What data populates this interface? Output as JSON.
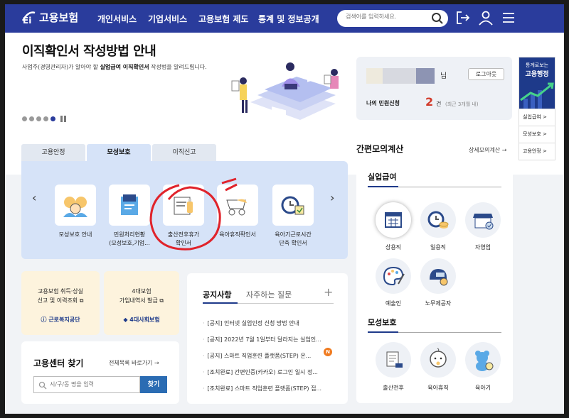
{
  "header": {
    "brand": "고용보험",
    "nav": [
      "개인서비스",
      "기업서비스",
      "고용보험 제도",
      "통계 및 정보공개"
    ],
    "search_placeholder": "검색어를 입력하세요."
  },
  "hero": {
    "title": "이직확인서 작성방법 안내",
    "subtitle_pre": "사업주(경영관리자)가 알아야 할 ",
    "subtitle_bold": "실업급여 이직확인서",
    "subtitle_post": " 작성법을 알려드립니다."
  },
  "user_card": {
    "name_suffix": "님",
    "logout": "로그아웃",
    "my_label": "나의 민원신청",
    "count": "2",
    "unit": "건",
    "period": "(최근 3개월 내)"
  },
  "side_panel": {
    "top_line1": "통계로보는",
    "top_line2": "고용행정",
    "items": [
      "실업급여 >",
      "모성보호 >",
      "고용안정 >"
    ]
  },
  "tabs": [
    "고용안정",
    "모성보호",
    "이직신고"
  ],
  "services": [
    {
      "label": "모성보호 안내",
      "icon": "family-icon"
    },
    {
      "label": "민원처리현황",
      "label2": "(모성보호,기업...",
      "icon": "folder-icon"
    },
    {
      "label": "출산전후휴가",
      "label2": "확인서",
      "icon": "document-bottle-icon"
    },
    {
      "label": "육아휴직확인서",
      "icon": "stroller-icon"
    },
    {
      "label": "육아기근로시간",
      "label2": "단축 확인서",
      "icon": "clock-calendar-icon"
    }
  ],
  "quick": [
    {
      "line1": "고용보험 취득·상실",
      "line2": "신고 및 이력조회",
      "org": "근로복지공단"
    },
    {
      "line1": "4대보험",
      "line2": "가입내역서 발급",
      "org": "4대사회보험"
    }
  ],
  "center": {
    "title": "고용센터 찾기",
    "all_link": "전체목록 바로가기",
    "placeholder": "시/구/동 명을 입력",
    "button": "찾기"
  },
  "notice": {
    "tab_active": "공지사항",
    "tab_other": "자주하는 질문",
    "plus": "+",
    "badge": "N",
    "items": [
      "[공지] 인터넷 실업인정 신청 방법 안내",
      "[공지] 2022년 7월 1일부터 달라지는 실업인...",
      "[공지] 스마트 직업훈련 플랫폼(STEP) 온...",
      "[조치완료] 간편인증(카카오) 로그인 일시 정...",
      "[조치완료] 스마트 직업훈련 플랫폼(STEP) 접..."
    ]
  },
  "calc": {
    "title": "간편모의계산",
    "detail_link": "상세모의계산",
    "section1": "실업급여",
    "section1_items": [
      {
        "label": "상용직",
        "icon": "calendar-icon"
      },
      {
        "label": "일용직",
        "icon": "clock-coins-icon"
      },
      {
        "label": "자영업",
        "icon": "store-icon"
      },
      {
        "label": "예술인",
        "icon": "palette-icon"
      },
      {
        "label": "노무제공자",
        "icon": "helmet-icon"
      }
    ],
    "section2": "모성보호",
    "section2_items": [
      {
        "label": "출산전후",
        "icon": "document-icon"
      },
      {
        "label": "육아휴직",
        "icon": "baby-icon"
      },
      {
        "label": "육아기",
        "icon": "teddy-bear-icon"
      }
    ]
  },
  "colors": {
    "brand": "#2a3c9c",
    "panel": "#d6e3f8",
    "accent_red": "#d23b2b",
    "quick_bg": "#fdf3dd",
    "button": "#2b6cb3"
  }
}
